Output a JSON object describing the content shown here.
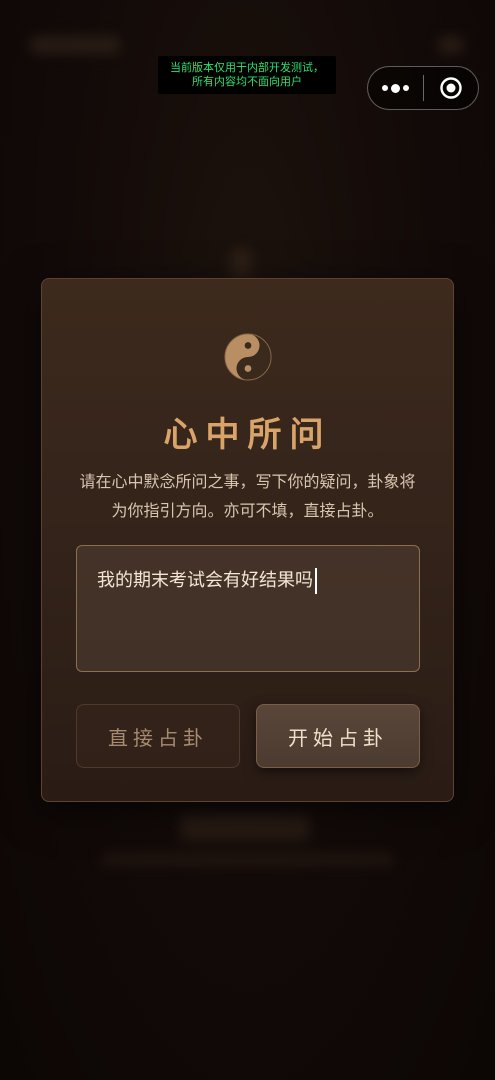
{
  "dev_notice": {
    "line1": "当前版本仅用于内部开发测试，",
    "line2": "所有内容均不面向用户"
  },
  "capsule": {
    "more_icon": "more-dots-icon",
    "close_icon": "target-close-icon"
  },
  "modal": {
    "icon": "taiji-icon",
    "title": "心中所问",
    "description": "请在心中默念所问之事，写下你的疑问，卦象将为你指引方向。亦可不填，直接占卦。",
    "question_value": "我的期末考试会有好结果吗",
    "buttons": {
      "direct": "直接占卦",
      "start": "开始占卦"
    }
  },
  "colors": {
    "accent": "#d9a46a",
    "notice_text": "#2ee06b",
    "background": "#120a08"
  }
}
